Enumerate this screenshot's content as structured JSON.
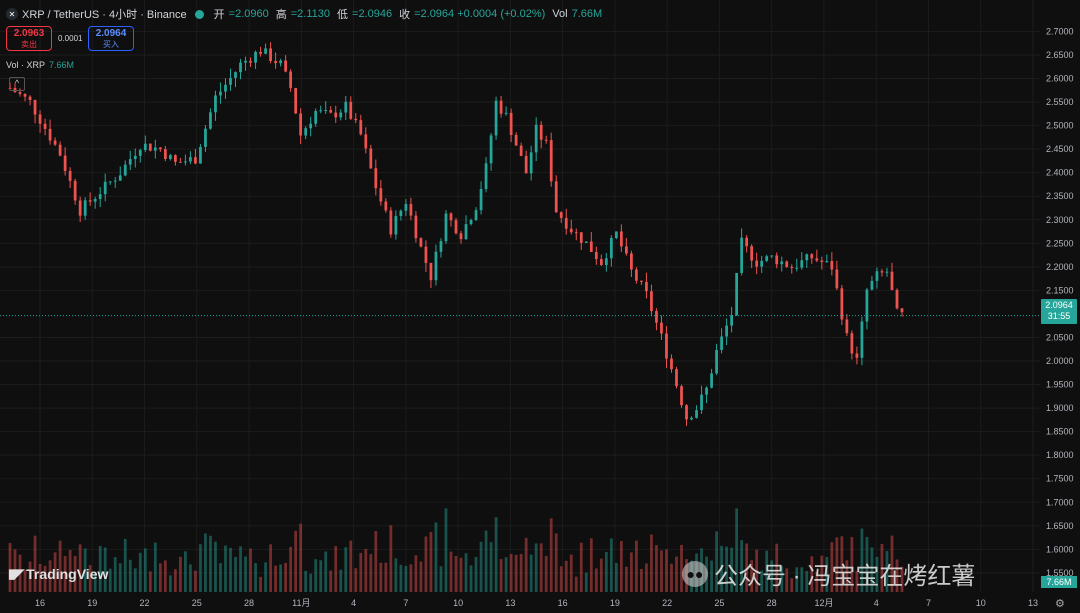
{
  "header": {
    "symbol": "XRP / TetherUS · 4小时 · Binance",
    "open_label": "开",
    "open": "=2.0960",
    "high_label": "高",
    "high": "=2.1130",
    "low_label": "低",
    "low": "=2.0946",
    "close_label": "收",
    "close": "=2.0964 +0.0004 (+0.02%)",
    "vol_label": "Vol",
    "vol": "7.66M"
  },
  "trade": {
    "sell_price": "2.0963",
    "sell_label": "卖出",
    "spread": "0.0001",
    "buy_price": "2.0964",
    "buy_label": "买入"
  },
  "volume_legend": {
    "label": "Vol · XRP",
    "value": "7.66M"
  },
  "collapse_icon_glyph": "^",
  "current_price": {
    "price": "2.0964",
    "countdown": "31:55"
  },
  "volume_tag": "7.66M",
  "logo_text": "TradingView",
  "watermark": "公众号 · 冯宝宝在烤红薯",
  "colors": {
    "up": "#26a69a",
    "down": "#ef5350",
    "background": "#0f0f0f"
  },
  "chart_data": {
    "type": "candlestick",
    "price_axis": {
      "range": [
        1.52,
        2.72
      ],
      "ticks": [
        "2.7000",
        "2.6500",
        "2.6000",
        "2.5500",
        "2.5000",
        "2.4500",
        "2.4000",
        "2.3500",
        "2.3000",
        "2.2500",
        "2.2000",
        "2.1500",
        "2.0500",
        "2.0000",
        "1.9500",
        "1.9000",
        "1.8500",
        "1.8000",
        "1.7500",
        "1.7000",
        "1.6500",
        "1.6000",
        "1.5500"
      ]
    },
    "time_axis": {
      "labels": [
        "16",
        "19",
        "22",
        "25",
        "28",
        "11月",
        "4",
        "7",
        "10",
        "13",
        "16",
        "19",
        "22",
        "25",
        "28",
        "12月",
        "4",
        "7",
        "10",
        "13"
      ]
    },
    "price_path": [
      [
        0,
        2.58
      ],
      [
        4,
        2.55
      ],
      [
        10,
        2.44
      ],
      [
        14,
        2.32
      ],
      [
        18,
        2.36
      ],
      [
        22,
        2.4
      ],
      [
        26,
        2.46
      ],
      [
        30,
        2.45
      ],
      [
        33,
        2.42
      ],
      [
        37,
        2.43
      ],
      [
        41,
        2.56
      ],
      [
        44,
        2.6
      ],
      [
        46,
        2.63
      ],
      [
        50,
        2.66
      ],
      [
        54,
        2.63
      ],
      [
        56,
        2.58
      ],
      [
        58,
        2.48
      ],
      [
        61,
        2.53
      ],
      [
        64,
        2.52
      ],
      [
        67,
        2.54
      ],
      [
        70,
        2.48
      ],
      [
        73,
        2.37
      ],
      [
        76,
        2.28
      ],
      [
        79,
        2.34
      ],
      [
        82,
        2.24
      ],
      [
        84,
        2.18
      ],
      [
        87,
        2.31
      ],
      [
        90,
        2.27
      ],
      [
        93,
        2.33
      ],
      [
        95,
        2.41
      ],
      [
        97,
        2.55
      ],
      [
        99,
        2.52
      ],
      [
        101,
        2.46
      ],
      [
        103,
        2.4
      ],
      [
        105,
        2.49
      ],
      [
        107,
        2.46
      ],
      [
        109,
        2.32
      ],
      [
        112,
        2.28
      ],
      [
        115,
        2.25
      ],
      [
        118,
        2.21
      ],
      [
        121,
        2.27
      ],
      [
        124,
        2.19
      ],
      [
        127,
        2.14
      ],
      [
        130,
        2.05
      ],
      [
        133,
        1.95
      ],
      [
        135,
        1.88
      ],
      [
        137,
        1.9
      ],
      [
        139,
        1.94
      ],
      [
        141,
        2.02
      ],
      [
        144,
        2.1
      ],
      [
        146,
        2.25
      ],
      [
        149,
        2.21
      ],
      [
        152,
        2.22
      ],
      [
        156,
        2.2
      ],
      [
        160,
        2.22
      ],
      [
        164,
        2.2
      ],
      [
        167,
        2.05
      ],
      [
        169,
        2.0
      ],
      [
        171,
        2.15
      ],
      [
        173,
        2.18
      ],
      [
        175,
        2.19
      ],
      [
        177,
        2.1
      ],
      [
        178,
        2.0964
      ]
    ],
    "volume_axis_max": 8.0,
    "volume_last": 7.66
  }
}
